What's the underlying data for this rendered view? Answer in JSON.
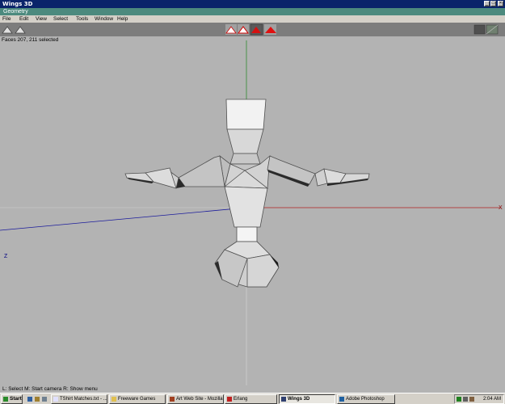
{
  "window": {
    "title": "Wings 3D",
    "controls": [
      "_",
      "□",
      "×"
    ]
  },
  "subwindow": {
    "title": "Geometry"
  },
  "menu": [
    "File",
    "Edit",
    "View",
    "Select",
    "Tools",
    "Window",
    "Help"
  ],
  "toolbar": {
    "left_icons": [
      "view-perspective-icon",
      "view-ortho-icon"
    ],
    "select_modes": [
      "vertex-mode-icon",
      "edge-mode-icon",
      "face-mode-icon",
      "body-mode-icon"
    ],
    "right_icons": [
      "smooth-preview-icon",
      "wireframe-icon"
    ]
  },
  "viewport": {
    "status": "Faces 207, 211 selected",
    "axis_x": "X",
    "axis_z": "Z"
  },
  "helpbar": {
    "text": "L: Select  M: Start camera  R: Show menu"
  },
  "taskbar": {
    "start_label": "Start",
    "tasks": [
      "TShirt Matches.txt - ...",
      "Freeware Games",
      "Art Web Site - Mozilla",
      "Erlang",
      "Wings 3D",
      "Adobe Photoshop"
    ],
    "clock": "2:04 AM"
  }
}
